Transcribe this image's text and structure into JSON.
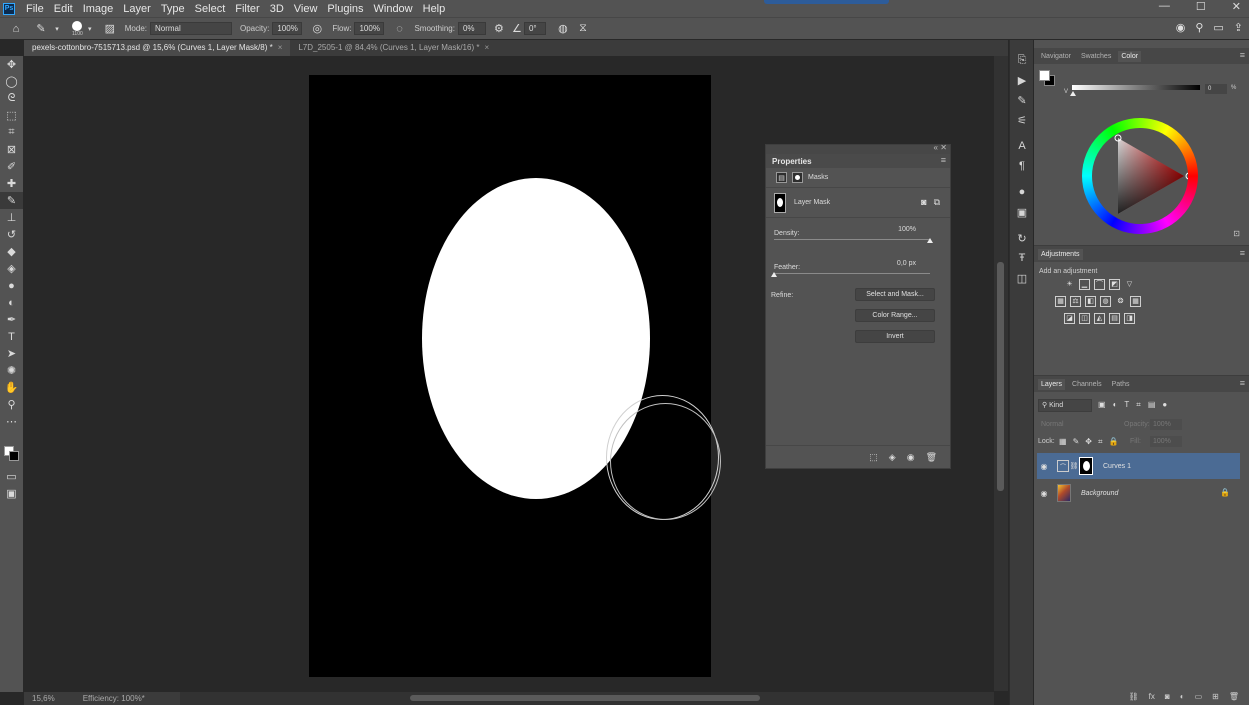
{
  "app": {
    "logo_text": "Ps",
    "menu": [
      "File",
      "Edit",
      "Image",
      "Layer",
      "Type",
      "Select",
      "Filter",
      "3D",
      "View",
      "Plugins",
      "Window",
      "Help"
    ],
    "window_controls": [
      "—",
      "☐",
      "✕"
    ]
  },
  "options_bar": {
    "brush_size": "1100",
    "mode_label": "Mode:",
    "mode_value": "Normal",
    "opacity_label": "Opacity:",
    "opacity_value": "100%",
    "flow_label": "Flow:",
    "flow_value": "100%",
    "smoothing_label": "Smoothing:",
    "smoothing_value": "0%",
    "angle_value": "0°"
  },
  "tabs": [
    {
      "label": "pexels-cottonbro-7515713.psd @ 15,6% (Curves 1, Layer Mask/8) *",
      "close": "×"
    },
    {
      "label": "L7D_2505-1 @ 84,4% (Curves 1, Layer Mask/16) *",
      "close": "×"
    }
  ],
  "status": {
    "zoom": "15,6%",
    "info": "Efficiency: 100%*"
  },
  "properties": {
    "title": "Properties",
    "collapse": "«",
    "close": "✕",
    "masks_label": "Masks",
    "layer_mask_label": "Layer Mask",
    "density_label": "Density:",
    "density_value": "100%",
    "density_level": 1.0,
    "feather_label": "Feather:",
    "feather_value": "0,0 px",
    "feather_level": 0.0,
    "refine_label": "Refine:",
    "buttons": {
      "select_and_mask": "Select and Mask...",
      "color_range": "Color Range...",
      "invert": "Invert"
    }
  },
  "color_panel": {
    "tabs": [
      "Navigator",
      "Swatches",
      "Color"
    ],
    "active_tab": "Color",
    "v_label": "V",
    "v_value": "0",
    "pct": "%",
    "foreground": "#ffffff",
    "background": "#000000"
  },
  "adjustments": {
    "title": "Adjustments",
    "subtitle": "Add an adjustment"
  },
  "layers_panel": {
    "tabs": [
      "Layers",
      "Channels",
      "Paths"
    ],
    "active_tab": "Layers",
    "filter_value": "Kind",
    "blend_mode": "Normal",
    "opacity_label": "Opacity:",
    "opacity_value": "100%",
    "lock_label": "Lock:",
    "fill_label": "Fill:",
    "fill_value": "100%",
    "layers": [
      {
        "name": "Curves 1",
        "selected": true
      },
      {
        "name": "Background",
        "selected": false
      }
    ]
  },
  "colors": {
    "accent": "#4b6b94",
    "panel_bg": "#535353",
    "workspace_bg": "#282828"
  }
}
